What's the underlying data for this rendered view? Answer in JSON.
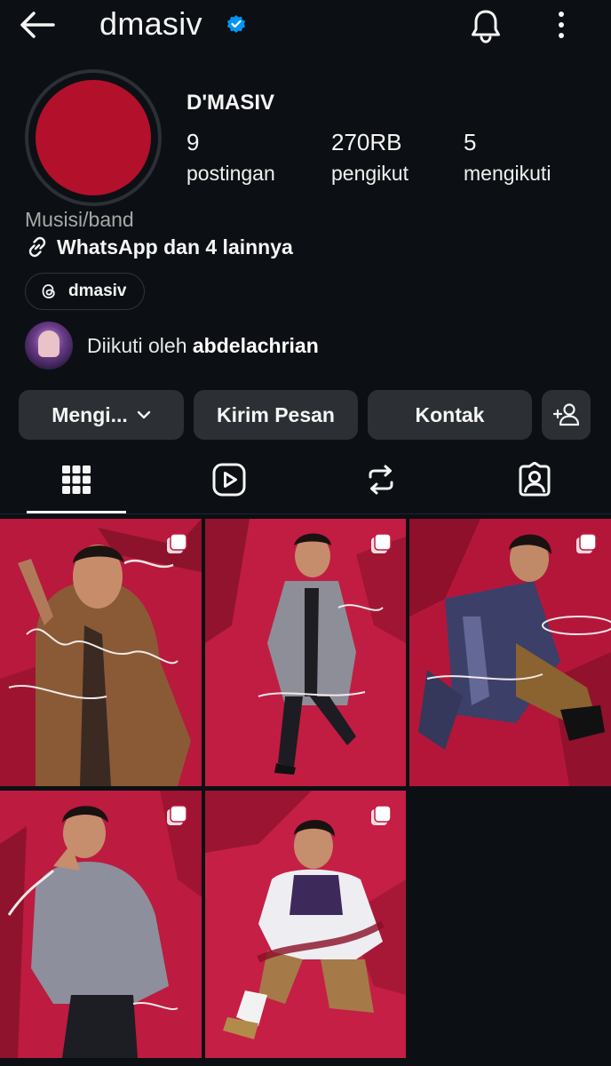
{
  "header": {
    "username": "dmasiv",
    "icons": [
      "back-arrow-icon",
      "verified-badge-icon",
      "bell-icon",
      "kebab-menu-icon"
    ]
  },
  "profile": {
    "display_name": "D'MASIV",
    "stats": [
      {
        "value": "9",
        "label": "postingan"
      },
      {
        "value": "270RB",
        "label": "pengikut"
      },
      {
        "value": "5",
        "label": "mengikuti"
      }
    ],
    "category": "Musisi/band",
    "link_text": "WhatsApp dan 4 lainnya",
    "threads_handle": "dmasiv",
    "followed_by_prefix": "Diikuti oleh ",
    "followed_by_user": "abdelachrian"
  },
  "actions": {
    "following_label": "Mengi...",
    "message_label": "Kirim Pesan",
    "contact_label": "Kontak"
  },
  "tabs": [
    "grid-icon",
    "reels-icon",
    "reposts-icon",
    "tagged-icon"
  ],
  "grid": {
    "posts": [
      {
        "name": "post-1",
        "type": "carousel"
      },
      {
        "name": "post-2",
        "type": "carousel"
      },
      {
        "name": "post-3",
        "type": "carousel"
      },
      {
        "name": "post-4",
        "type": "carousel"
      },
      {
        "name": "post-5",
        "type": "carousel"
      }
    ]
  },
  "colors": {
    "background": "#0c1014",
    "button": "#2c3035",
    "verified": "#0095f6",
    "avatar": "#b3102b",
    "muted": "#a8a8a8"
  }
}
